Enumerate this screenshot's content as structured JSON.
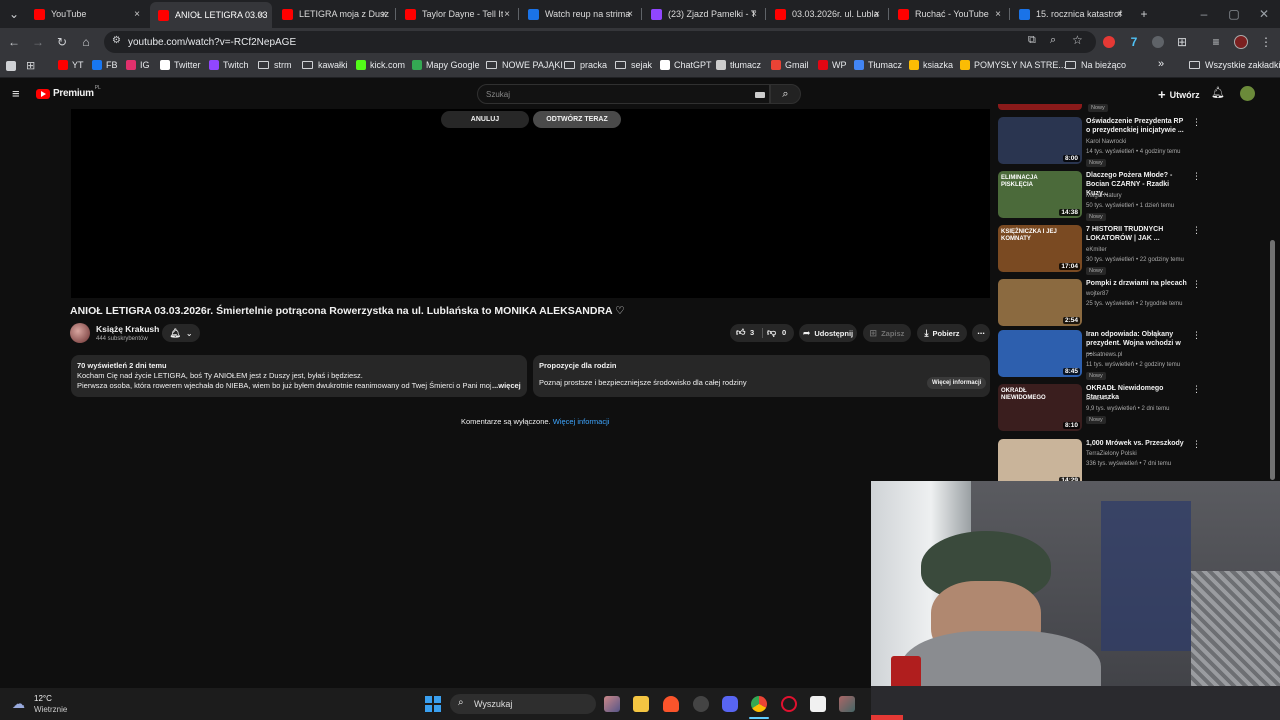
{
  "browser": {
    "tabs": [
      {
        "title": "YouTube",
        "color": "#ff0000"
      },
      {
        "title": "ANIOŁ LETIGRA 03.03",
        "color": "#ff0000",
        "active": true
      },
      {
        "title": "LETIGRA moja z Dusz",
        "color": "#ff0000"
      },
      {
        "title": "Taylor Dayne - Tell It",
        "color": "#ff0000"
      },
      {
        "title": "Watch reup na strima",
        "color": "#1a73e8"
      },
      {
        "title": "(23) Zjazd Pamelki - T",
        "color": "#9146ff"
      },
      {
        "title": "03.03.2026r. ul. Lubla",
        "color": "#ff0000"
      },
      {
        "title": "Ruchać - YouTube",
        "color": "#ff0000"
      },
      {
        "title": "15. rocznica katastrof",
        "color": "#1a73e8"
      }
    ],
    "close_glyph": "×",
    "new_tab_glyph": "+",
    "url": "youtube.com/watch?v=-RCf2NepAGE",
    "bookmarks": [
      {
        "label": "YT",
        "icon": "youtube-icon",
        "color": "#ff0000"
      },
      {
        "label": "FB",
        "icon": "facebook-icon",
        "color": "#1877f2"
      },
      {
        "label": "IG",
        "icon": "instagram-icon",
        "color": "#e1306c"
      },
      {
        "label": "Twitter",
        "icon": "x-icon",
        "color": "#ffffff"
      },
      {
        "label": "Twitch",
        "icon": "twitch-icon",
        "color": "#9146ff"
      },
      {
        "label": "strm",
        "icon": "folder-icon"
      },
      {
        "label": "kawałki",
        "icon": "folder-icon"
      },
      {
        "label": "kick.com",
        "icon": "kick-icon",
        "color": "#53fc18"
      },
      {
        "label": "Mapy Google",
        "icon": "maps-icon",
        "color": "#34a853"
      },
      {
        "label": "NOWE PAJĄKI",
        "icon": "folder-icon"
      },
      {
        "label": "pracka",
        "icon": "folder-icon"
      },
      {
        "label": "sejak",
        "icon": "folder-icon"
      },
      {
        "label": "ChatGPT",
        "icon": "chatgpt-icon",
        "color": "#ffffff"
      },
      {
        "label": "tłumacz",
        "icon": "globe-icon",
        "color": "#cccccc"
      },
      {
        "label": "Gmail",
        "icon": "gmail-icon",
        "color": "#ea4335"
      },
      {
        "label": "WP",
        "icon": "wp-icon",
        "color": "#e30613"
      },
      {
        "label": "Tłumacz",
        "icon": "translate-icon",
        "color": "#4285f4"
      },
      {
        "label": "ksiazka",
        "icon": "apps-icon",
        "color": "#fbbc04"
      },
      {
        "label": "POMYSŁY NA STRE...",
        "icon": "bookmark-icon",
        "color": "#fbbc04"
      },
      {
        "label": "Na bieżąco",
        "icon": "folder-icon"
      }
    ],
    "more_bookmarks": "»",
    "all_bookmarks": "Wszystkie zakładki"
  },
  "yt": {
    "logo_text": "Premium",
    "logo_sup": "PL",
    "search_placeholder": "Szukaj",
    "create_label": "Utwórz",
    "player": {
      "cancel_label": "ANULUJ",
      "play_now_label": "ODTWÓRZ TERAZ"
    },
    "video": {
      "title": "ANIOŁ LETIGRA 03.03.2026r. Śmiertelnie potrącona Rowerzystka na ul. Lublańska to MONIKA ALEKSANDRA ♡",
      "channel": "Książę Krakush",
      "subscribers": "444 subskrybentów",
      "likes": "3",
      "dislikes": "0",
      "share_label": "Udostępnij",
      "save_label": "Zapisz",
      "download_label": "Pobierz",
      "views_time": "70 wyświetleń  2 dni temu",
      "desc_line1": "Kocham Cię nad życie LETIGRA, boś Ty ANIOŁEM jest z Duszy jest, byłaś i będziesz.",
      "desc_line2": "Pierwsza osoba, która rowerem wjechała do NIEBA, wiem bo już byłem dwukrotnie reanimowany od Twej Śmierci o Pani moja LETIGR",
      "desc_more": "...więcej",
      "family_title": "Propozycje dla rodzin",
      "family_text": "Poznaj prostsze i bezpieczniejsze środowisko dla całej rodziny",
      "family_button": "Więcej informacji",
      "comments_off": "Komentarze są wyłączone.",
      "comments_link": "Więcej informacji"
    },
    "recommendations": [
      {
        "title": "Oświadczenie Prezydenta RP o prezydenckiej inicjatywie ...",
        "channel": "Karol Nawrocki",
        "meta": "14 tys. wyświetleń • 4 godziny temu",
        "badge": "Nowy",
        "duration": "8:00",
        "thumb": "#2a3550"
      },
      {
        "title": "Dlaczego Pożera Młode? - Bocian CZARNY - Rzadki Kuzy...",
        "channel": "Magia Natury",
        "meta": "50 tys. wyświetleń • 1 dzień temu",
        "badge": "Nowy",
        "duration": "14:38",
        "thumb": "#4b6a3a",
        "thumb_text": "ELIMINACJA PISKLĘCIA"
      },
      {
        "title": "7 HISTORII TRUDNYCH LOKATORÓW | JAK ...",
        "channel": "eKmiter",
        "meta": "30 tys. wyświetleń • 22 godziny temu",
        "badge": "Nowy",
        "duration": "17:04",
        "thumb": "#7a4a22",
        "thumb_text": "KSIĘŻNICZKA I JEJ KOMNATY"
      },
      {
        "title": "Pompki z drzwiami na plecach",
        "channel": "wojter87",
        "meta": "25 tys. wyświetleń • 2 tygodnie temu",
        "badge": "",
        "duration": "2:54",
        "thumb": "#8b6a40"
      },
      {
        "title": "Iran odpowiada: Obłąkany prezydent. Wojna wchodzi w ...",
        "channel": "polsatnews.pl",
        "meta": "11 tys. wyświetleń • 2 godziny temu",
        "badge": "Nowy",
        "duration": "8:45",
        "thumb": "#2d5fae"
      },
      {
        "title": "OKRADŁ Niewidomego Staruszka",
        "channel": "LukasTV",
        "meta": "9,9 tys. wyświetleń • 2 dni temu",
        "badge": "Nowy",
        "duration": "8:10",
        "thumb": "#3a1e1e",
        "thumb_text": "OKRADŁ NIEWIDOMEGO"
      },
      {
        "title": "1,000 Mrówek vs. Przeszkody",
        "channel": "TerraZielony Polski",
        "meta": "336 tys. wyświetleń • 7 dni temu",
        "badge": "",
        "duration": "14:29",
        "thumb": "#c9b49a"
      }
    ]
  },
  "taskbar": {
    "temperature": "12°C",
    "weather": "Wietrznie",
    "search_label": "Wyszukaj"
  },
  "colors": {
    "accent_blue": "#3ea6ff",
    "yt_red": "#ff0000"
  }
}
